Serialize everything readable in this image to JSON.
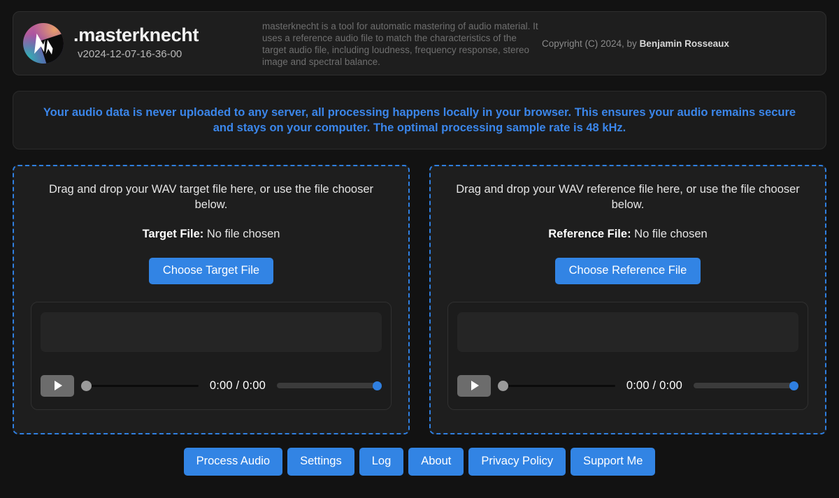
{
  "header": {
    "logo_icon": "masterknecht-logo-icon",
    "title": ".masterknecht",
    "version": "v2024-12-07-16-36-00",
    "description": "masterknecht is a tool for automatic mastering of audio material. It uses a reference audio file to match the characteristics of the target audio file, including loudness, frequency response, stereo image and spectral balance.",
    "copyright_prefix": "Copyright (C) 2024, by ",
    "copyright_author": "Benjamin Rosseaux"
  },
  "notice": {
    "text": "Your audio data is never uploaded to any server, all processing happens locally in your browser. This ensures your audio remains secure and stays on your computer. The optimal processing sample rate is 48 kHz.",
    "color": "#3b86ea"
  },
  "zones": [
    {
      "hint": "Drag and drop your WAV target file here, or use the file chooser below.",
      "file_label": "Target File:",
      "file_value": "No file chosen",
      "choose_button": "Choose Target File",
      "player": {
        "play_icon": "play-icon",
        "time": "0:00 / 0:00",
        "seek_position_percent": 0,
        "volume_percent": 100
      }
    },
    {
      "hint": "Drag and drop your WAV reference file here, or use the file chooser below.",
      "file_label": "Reference File:",
      "file_value": "No file chosen",
      "choose_button": "Choose Reference File",
      "player": {
        "play_icon": "play-icon",
        "time": "0:00 / 0:00",
        "seek_position_percent": 0,
        "volume_percent": 100
      }
    }
  ],
  "footer": {
    "buttons": [
      {
        "label": "Process Audio"
      },
      {
        "label": "Settings"
      },
      {
        "label": "Log"
      },
      {
        "label": "About"
      },
      {
        "label": "Privacy Policy"
      },
      {
        "label": "Support Me"
      }
    ]
  },
  "theme": {
    "page_background": "#121212",
    "panel_background": "#1e1e1e",
    "accent_blue": "#3284e4",
    "dropzone_border": "#2f7fe0"
  }
}
